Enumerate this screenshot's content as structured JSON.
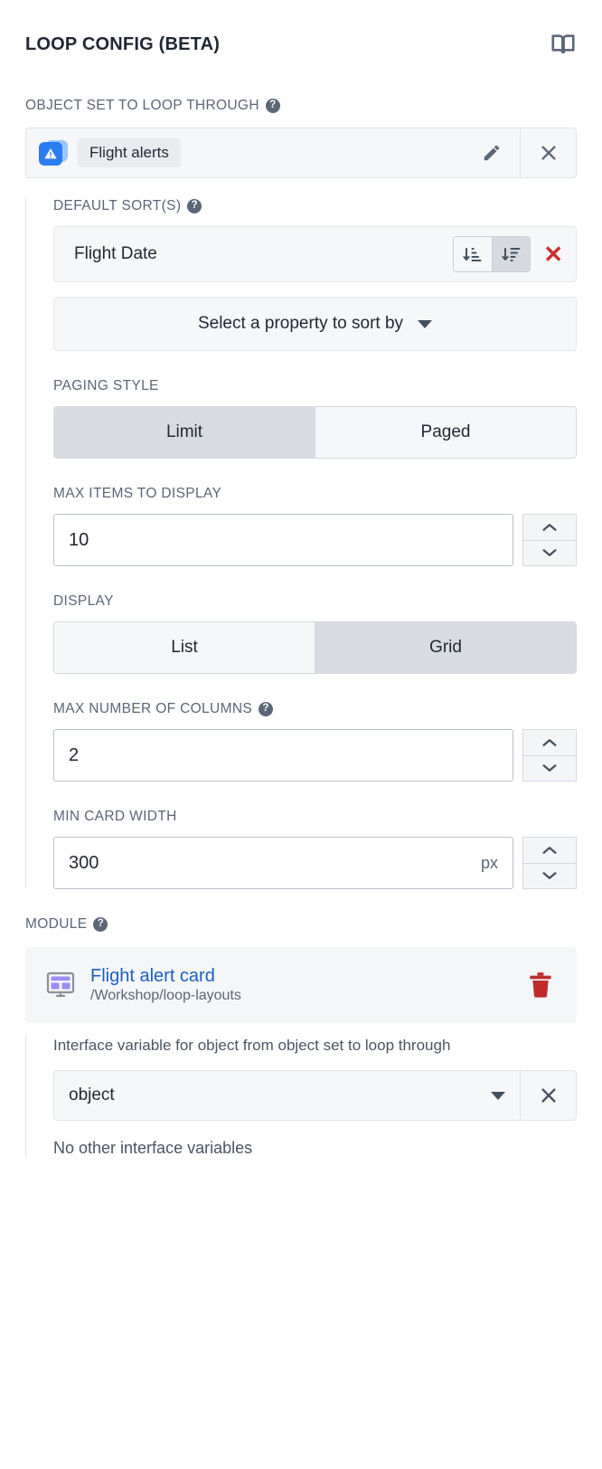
{
  "header": {
    "title": "LOOP CONFIG (BETA)",
    "docs_icon": "book-icon"
  },
  "object_set": {
    "label": "OBJECT SET TO LOOP THROUGH",
    "help": "?",
    "type_icon": "warning-triangle-icon",
    "value": "Flight alerts",
    "edit_icon": "pencil-icon",
    "clear_icon": "close-icon"
  },
  "default_sorts": {
    "label": "DEFAULT SORT(S)",
    "help": "?",
    "items": [
      {
        "property": "Flight Date",
        "ascending_icon": "sort-ascending-icon",
        "descending_icon": "sort-descending-icon",
        "direction": "descending",
        "remove_label": "✕"
      }
    ],
    "add_placeholder": "Select a property to sort by"
  },
  "paging_style": {
    "label": "PAGING STYLE",
    "options": [
      "Limit",
      "Paged"
    ],
    "selected": "Limit"
  },
  "max_items": {
    "label": "MAX ITEMS TO DISPLAY",
    "value": "10",
    "unit": "",
    "increment_icon": "chevron-up-icon",
    "decrement_icon": "chevron-down-icon"
  },
  "display": {
    "label": "DISPLAY",
    "options": [
      "List",
      "Grid"
    ],
    "selected": "Grid"
  },
  "max_columns": {
    "label": "MAX NUMBER OF COLUMNS",
    "help": "?",
    "value": "2",
    "unit": ""
  },
  "min_card_width": {
    "label": "MIN CARD WIDTH",
    "value": "300",
    "unit": "px"
  },
  "module": {
    "label": "MODULE",
    "help": "?",
    "icon": "layout-screen-icon",
    "title": "Flight alert card",
    "path": "/Workshop/loop-layouts",
    "delete_icon": "trash-icon",
    "interface_variable": {
      "description": "Interface variable for object from object set to loop through",
      "value": "object",
      "clear_icon": "close-icon",
      "empty_text": "No other interface variables"
    }
  },
  "colors": {
    "accent_link": "#1e5fc0",
    "object_icon": "#2b7cf0",
    "object_icon_back": "#9ec5fb",
    "danger": "#c5302e",
    "trash": "#bf2c2c",
    "label_text": "#5b6676",
    "module_icon": "#8b7cf0",
    "selected_segment": "#d8dce2"
  }
}
